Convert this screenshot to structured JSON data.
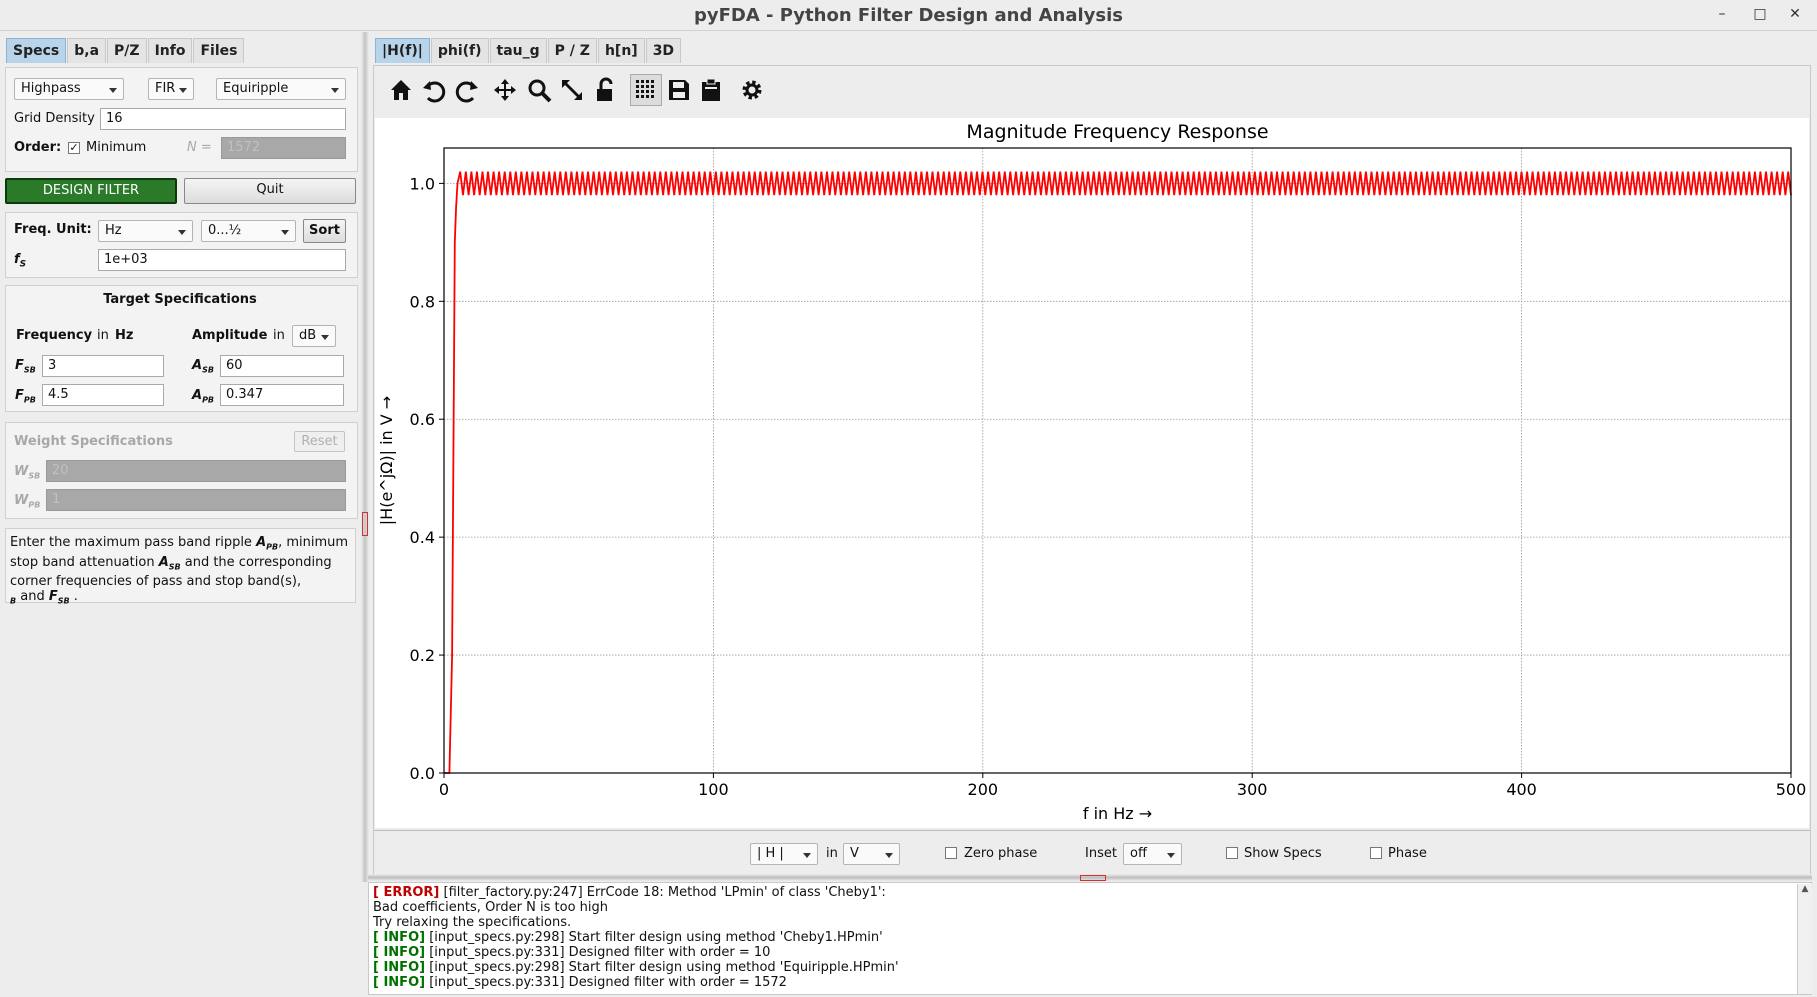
{
  "window": {
    "title": "pyFDA - Python Filter Design and Analysis"
  },
  "left_tabs": [
    "Specs",
    "b,a",
    "P/Z",
    "Info",
    "Files"
  ],
  "specs": {
    "response_type": "Highpass",
    "filter_type": "FIR",
    "design_method": "Equiripple",
    "grid_density_label": "Grid Density",
    "grid_density": "16",
    "order_label": "Order:",
    "minimum_label": "Minimum",
    "minimum_checked": true,
    "n_label": "N =",
    "n_value": "1572",
    "design_button": "DESIGN FILTER",
    "quit_button": "Quit",
    "freq_unit_label": "Freq. Unit:",
    "freq_unit": "Hz",
    "freq_range": "0...½",
    "sort_button": "Sort",
    "fs_label": "f",
    "fs_sub": "S",
    "fs_value": "1e+03"
  },
  "target_specs": {
    "title": "Target Specifications",
    "frequency_label": "Frequency",
    "in_label": "in",
    "unit_label": "Hz",
    "amplitude_label": "Amplitude",
    "amp_in_label": "in",
    "amp_unit": "dB",
    "fsb_label": "F",
    "fsb_sub": "SB",
    "fsb_value": "3",
    "fpb_label": "F",
    "fpb_sub": "PB",
    "fpb_value": "4.5",
    "asb_label": "A",
    "asb_sub": "SB",
    "asb_value": "60",
    "apb_label": "A",
    "apb_sub": "PB",
    "apb_value": "0.347"
  },
  "weight_specs": {
    "title": "Weight Specifications",
    "reset_button": "Reset",
    "wsb_label": "W",
    "wsb_sub": "SB",
    "wsb_value": "20",
    "wpb_label": "W",
    "wpb_sub": "PB",
    "wpb_value": "1"
  },
  "info_text": {
    "line1a": "Enter the maximum pass band ripple ",
    "line1b": ", minimum",
    "line2a": "stop band attenuation ",
    "line2b": " and the corresponding",
    "line3": "corner frequencies of pass and stop band(s),",
    "line4a": " and ",
    "line4b": " ."
  },
  "plot_tabs": [
    "|H(f)|",
    "phi(f)",
    "tau_g",
    "P / Z",
    "h[n]",
    "3D"
  ],
  "toolbar_icons": [
    "home-icon",
    "undo-icon",
    "redo-icon",
    "pan-icon",
    "zoom-icon",
    "full-view-icon",
    "lock-icon",
    "grid-icon",
    "save-icon",
    "clipboard-icon",
    "settings-icon"
  ],
  "plot_controls": {
    "mag_select": "| H |",
    "in_label": "in",
    "unit_select": "V",
    "zero_phase_label": "Zero phase",
    "inset_label": "Inset",
    "inset_select": "off",
    "show_specs_label": "Show Specs",
    "phase_label": "Phase"
  },
  "chart_data": {
    "type": "line",
    "title": "Magnitude Frequency Response",
    "xlabel": "f in Hz →",
    "ylabel": "|H(e^jΩ)| in V →",
    "xlim": [
      0,
      500
    ],
    "ylim": [
      0,
      1.06
    ],
    "xticks": [
      0,
      100,
      200,
      300,
      400,
      500
    ],
    "xtick_labels": [
      "0",
      "100",
      "200",
      "300",
      "400",
      "500"
    ],
    "yticks": [
      0.0,
      0.2,
      0.4,
      0.6,
      0.8,
      1.0
    ],
    "ytick_labels": [
      "0.0",
      "0.2",
      "0.4",
      "0.6",
      "0.8",
      "1.0"
    ],
    "grid": true,
    "series": [
      {
        "color": "#ff0000",
        "x": [
          0,
          2,
          3,
          4,
          4.5,
          5,
          500
        ],
        "values": [
          0.0,
          0.0,
          0.2,
          0.9,
          0.96,
          1.0,
          1.0
        ],
        "ripple": 0.02
      }
    ]
  },
  "log": [
    {
      "level": "[ ERROR]",
      "text": " [filter_factory.py:247] ErrCode 18: Method 'LPmin' of class 'Cheby1':"
    },
    {
      "level": "",
      "text": "Bad coefficients, Order N is too high"
    },
    {
      "level": "",
      "text": "Try relaxing the specifications."
    },
    {
      "level": "[ INFO]",
      "text": " [input_specs.py:298] Start filter design using method 'Cheby1.HPmin'"
    },
    {
      "level": "[ INFO]",
      "text": " [input_specs.py:331] Designed filter with order = 10"
    },
    {
      "level": "[ INFO]",
      "text": " [input_specs.py:298] Start filter design using method 'Equiripple.HPmin'"
    },
    {
      "level": "[ INFO]",
      "text": " [input_specs.py:331] Designed filter with order = 1572"
    }
  ]
}
